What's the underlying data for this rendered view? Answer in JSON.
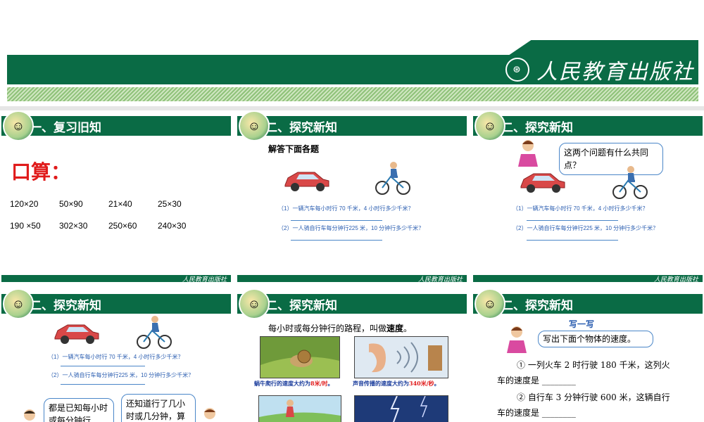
{
  "brand": {
    "name": "人民教育出版社",
    "footer": "人民教育出版社"
  },
  "slides": [
    {
      "title": "一、复习旧知",
      "heading": "口算：",
      "rows": [
        [
          "120×20",
          "50×90",
          "21×40",
          "25×30"
        ],
        [
          "190 ×50",
          "302×30",
          "250×60",
          "240×30"
        ]
      ]
    },
    {
      "title": "二、探究新知",
      "subtitle": "解答下面各题",
      "q1": "（1）一辆汽车每小时行 70 千米，4 小时行多少千米？",
      "q2": "（2）一人骑自行车每分钟行225 米，10 分钟行多少千米？"
    },
    {
      "title": "二、探究新知",
      "bubble": "这两个问题有什么共同点？",
      "q1": "（1）一辆汽车每小时行 70 千米，4 小时行多少千米？",
      "q2": "（2）一人骑自行车每分钟行225 米，10 分钟行多少千米？"
    },
    {
      "title": "二、探究新知",
      "q1": "（1）一辆汽车每小时行 70 千米，4 小时行多少千米？",
      "q2": "（2）一人骑自行车每分钟行225 米，10 分钟行多少千米？",
      "bubble_left": "都是已知每小时或每分钟行",
      "bubble_right": "还知道行了几小时或几分钟，算"
    },
    {
      "title": "二、探究新知",
      "intro_a": "每小时或每分钟行的路程，叫做",
      "intro_b": "速度",
      "intro_c": "。",
      "cap1_a": "蜗牛爬行的速度大约为",
      "cap1_b": "8米/时",
      "cap1_c": "。",
      "cap2_a": "声音传播的速度大约为",
      "cap2_b": "340米/秒",
      "cap2_c": "。"
    },
    {
      "title": "二、探究新知",
      "subtitle": "写一写",
      "bubble": "写出下面个物体的速度。",
      "item1": "① 一列火车 2 时行驶 180 千米，这列火车的速度是 ________",
      "item2": "② 自行车 3 分钟行驶 600 米，这辆自行车的速度是 ________"
    }
  ],
  "colors": {
    "green": "#0a6b45",
    "red": "#e01b1b",
    "blue": "#2a5db0"
  }
}
